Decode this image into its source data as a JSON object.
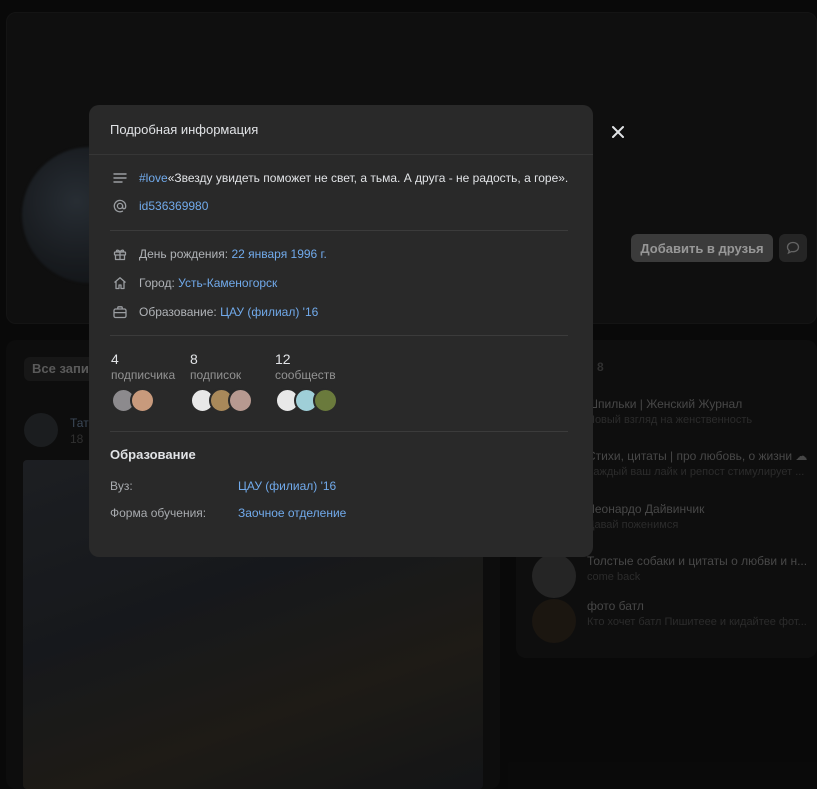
{
  "background": {
    "add_friend_label": "Добавить в друзья",
    "wall_tab_label": "Все записи",
    "post_author": "Тат",
    "post_date": "18",
    "groups_count": "8",
    "groups": [
      {
        "name": "Шпильки | Женский Журнал",
        "subtitle": "Новый взгляд на женственность"
      },
      {
        "name": "Стихи, цитаты | про любовь, о жизни ☁",
        "subtitle": "Каждый ваш лайк и репост стимулирует ..."
      },
      {
        "name": "Леонардо Дайвинчик",
        "subtitle": "Давай поженимся"
      },
      {
        "name": "Толстые собаки и цитаты о любви и н...",
        "subtitle": "come back"
      },
      {
        "name": "фото батл",
        "subtitle": "Кто хочет батл Пишитеее и кидайтее фот..."
      }
    ]
  },
  "modal": {
    "title": "Подробная информация",
    "status_hashtag": "#love",
    "status_text": " «Звезду увидеть поможет не свет, а тьма. А друга - не радость, а горе».",
    "user_id": "id536369980",
    "birthday_label": "День рождения: ",
    "birthday_value": "22 января 1996 г.",
    "city_label": "Город: ",
    "city_value": "Усть-Каменогорск",
    "education_label": "Образование: ",
    "education_value": "ЦАУ (филиал) '16",
    "stats": [
      {
        "count": "4",
        "label": "подписчика"
      },
      {
        "count": "8",
        "label": "подписок"
      },
      {
        "count": "12",
        "label": "сообществ"
      }
    ],
    "education_section_title": "Образование",
    "university_label": "Вуз:",
    "university_value": "ЦАУ (филиал) '16",
    "study_form_label": "Форма обучения:",
    "study_form_value": "Заочное отделение"
  },
  "colors": {
    "link": "#71aaeb",
    "modal_bg": "#292929",
    "page_bg": "#0f0f0f"
  }
}
